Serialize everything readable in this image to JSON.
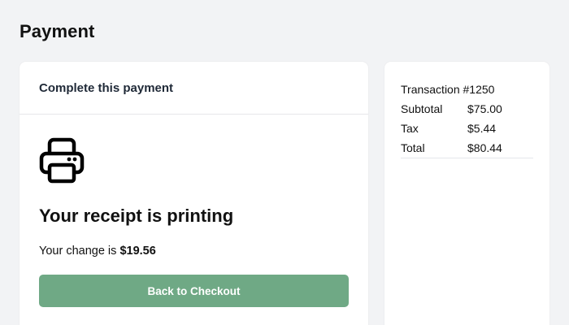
{
  "page": {
    "title": "Payment"
  },
  "payment": {
    "header": "Complete this payment",
    "icon": "printer-icon",
    "status_heading": "Your receipt is printing",
    "change_prefix": "Your change is",
    "change_amount": "$19.56",
    "back_button_label": "Back to Checkout",
    "button_color": "#6fa985"
  },
  "summary": {
    "title": "Transaction #1250",
    "rows": [
      {
        "label": "Subtotal",
        "value": "$75.00"
      },
      {
        "label": "Tax",
        "value": "$5.44"
      },
      {
        "label": "Total",
        "value": "$80.44"
      }
    ]
  }
}
